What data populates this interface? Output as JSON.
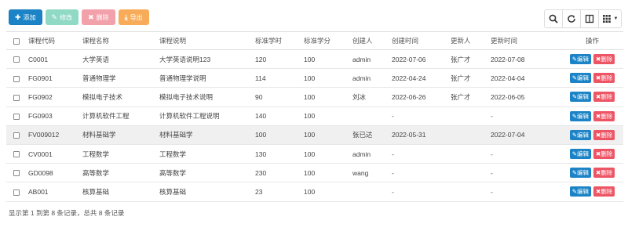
{
  "toolbar": {
    "add_label": "添加",
    "edit_label": "修改",
    "delete_label": "删除",
    "export_label": "导出"
  },
  "colors": {
    "primary": "#1c84c6",
    "danger": "#ed5565",
    "edit_disabled": "#8fd9c5",
    "delete_disabled": "#f2a0a9",
    "export": "#f8ac59"
  },
  "table": {
    "headers": {
      "code": "课程代码",
      "name": "课程名称",
      "desc": "课程说明",
      "hours": "标准学时",
      "credits": "标准学分",
      "creator": "创建人",
      "created": "创建时间",
      "updater": "更新人",
      "updated": "更新时间",
      "actions": "操作"
    },
    "action_labels": {
      "edit": "编辑",
      "delete": "删除"
    },
    "rows": [
      {
        "code": "C0001",
        "name": "大学英语",
        "desc": "大学英语说明123",
        "hours": "120",
        "credits": "100",
        "creator": "admin",
        "created": "2022-07-06",
        "updater": "张广才",
        "updated": "2022-07-08"
      },
      {
        "code": "FG0901",
        "name": "普通物理学",
        "desc": "普通物理学说明",
        "hours": "114",
        "credits": "100",
        "creator": "admin",
        "created": "2022-04-24",
        "updater": "张广才",
        "updated": "2022-04-04"
      },
      {
        "code": "FG0902",
        "name": "模拟电子技术",
        "desc": "模拟电子技术说明",
        "hours": "90",
        "credits": "100",
        "creator": "刘冰",
        "created": "2022-06-26",
        "updater": "张广才",
        "updated": "2022-06-05"
      },
      {
        "code": "FG0903",
        "name": "计算机软件工程",
        "desc": "计算机软件工程说明",
        "hours": "140",
        "credits": "100",
        "creator": "",
        "created": "-",
        "updater": "",
        "updated": "-"
      },
      {
        "code": "FV009012",
        "name": "材料基础学",
        "desc": "材料基础学",
        "hours": "100",
        "credits": "100",
        "creator": "张已达",
        "created": "2022-05-31",
        "updater": "",
        "updated": "2022-07-04"
      },
      {
        "code": "CV0001",
        "name": "工程数学",
        "desc": "工程数学",
        "hours": "130",
        "credits": "100",
        "creator": "admin",
        "created": "-",
        "updater": "",
        "updated": "-"
      },
      {
        "code": "GD0098",
        "name": "高等数学",
        "desc": "高等数学",
        "hours": "230",
        "credits": "100",
        "creator": "wang",
        "created": "-",
        "updater": "",
        "updated": "-"
      },
      {
        "code": "AB001",
        "name": "核算基础",
        "desc": "核算基础",
        "hours": "23",
        "credits": "100",
        "creator": "",
        "created": "-",
        "updater": "",
        "updated": "-"
      }
    ]
  },
  "footer": {
    "summary": "显示第 1 到第 8 条记录，总共 8 条记录"
  }
}
